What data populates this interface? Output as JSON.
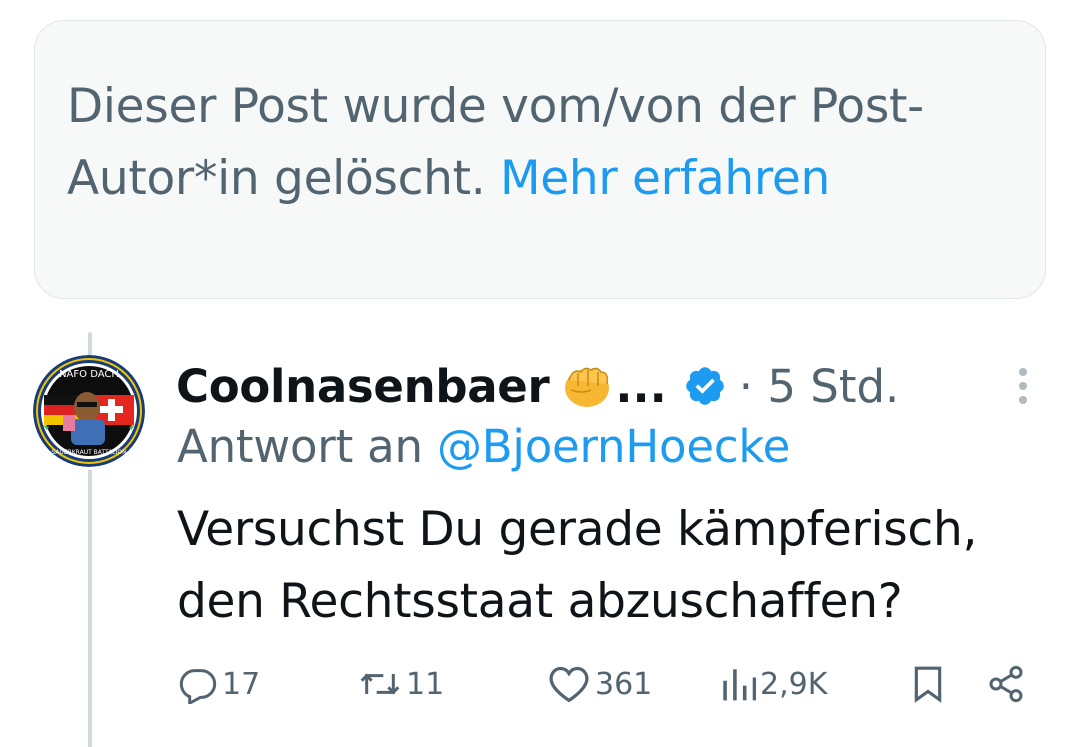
{
  "deleted_notice": {
    "text": "Dieser Post wurde vom/von der Post-Autor*in gelöscht.",
    "link": "Mehr erfahren"
  },
  "tweet": {
    "author": "Coolnasenbaer",
    "author_ellipsis": "...",
    "emoji_icon": "fist-emoji-icon",
    "verified_icon": "verified-badge-icon",
    "time": "· 5 Std.",
    "reply_prefix": "Antwort an",
    "reply_handle": "@BjoernHoecke",
    "text": "Versuchst Du gerade kämpferisch, den Rechtsstaat abzuschaffen?",
    "avatar_text_top": "NAFO DACH",
    "avatar_text_bottom": "SAUERKRAUT BATTALION"
  },
  "actions": {
    "replies": "17",
    "retweets": "11",
    "likes": "361",
    "views": "2,9K"
  },
  "colors": {
    "accent": "#1d9bf0",
    "secondary_text": "#536471",
    "notice_bg": "#f7f9f9"
  }
}
